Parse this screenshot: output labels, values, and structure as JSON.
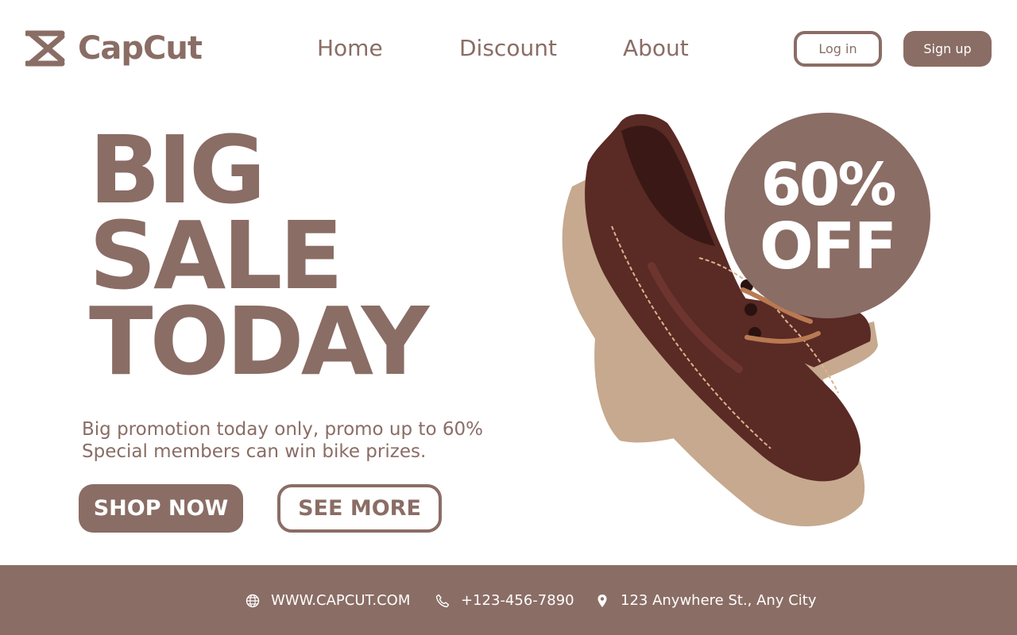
{
  "brand": {
    "name": "CapCut"
  },
  "nav": {
    "home": "Home",
    "discount": "Discount",
    "about": "About"
  },
  "auth": {
    "login": "Log in",
    "signup": "Sign up"
  },
  "hero": {
    "headline": [
      "BIG",
      "SALE",
      "TODAY"
    ],
    "promo_lines": [
      "Big promotion today only, promo up to 60%",
      "Special members can win bike prizes."
    ],
    "shop_now": "SHOP NOW",
    "see_more": "SEE MORE",
    "badge": {
      "percent": "60%",
      "off": "OFF"
    }
  },
  "footer": {
    "website": "WWW.CAPCUT.COM",
    "phone": "+123-456-7890",
    "address": "123 Anywhere St., Any City"
  },
  "colors": {
    "accent": "#8a6d65",
    "shoe_leather": "#5a2a25",
    "sole": "#c6a98e"
  }
}
